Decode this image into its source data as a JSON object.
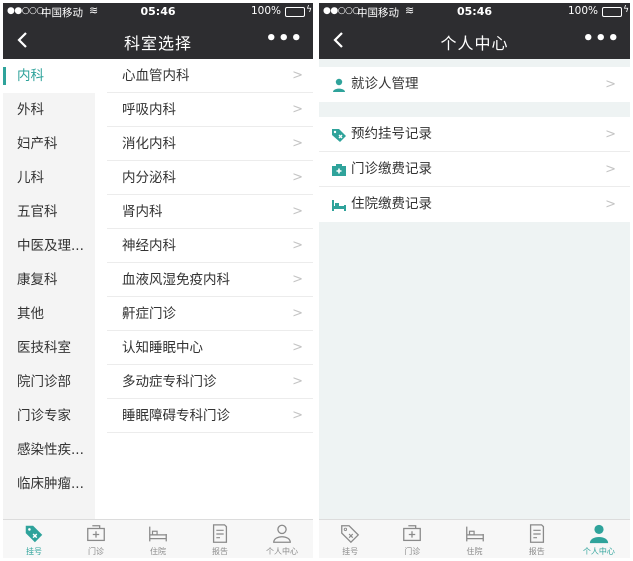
{
  "status": {
    "signal": "●●○○○",
    "carrier": "中国移动",
    "time": "05:46",
    "battery": "100%"
  },
  "left": {
    "title": "科室选择",
    "categories": [
      "内科",
      "外科",
      "妇产科",
      "儿科",
      "五官科",
      "中医及理...",
      "康复科",
      "其他",
      "医技科室",
      "院门诊部",
      "门诊专家",
      "感染性疾...",
      "临床肿瘤..."
    ],
    "active_category": "内科",
    "departments": [
      "心血管内科",
      "呼吸内科",
      "消化内科",
      "内分泌科",
      "肾内科",
      "神经内科",
      "血液风湿免疫内科",
      "鼾症门诊",
      "认知睡眠中心",
      "多动症专科门诊",
      "睡眠障碍专科门诊"
    ]
  },
  "right": {
    "title": "个人中心",
    "menu_group1": [
      "就诊人管理"
    ],
    "menu_group2": [
      "预约挂号记录",
      "门诊缴费记录",
      "住院缴费记录"
    ]
  },
  "tabs": [
    "挂号",
    "门诊",
    "住院",
    "报告",
    "个人中心"
  ],
  "colors": {
    "accent": "#2fa39b",
    "bar_dark": "#2d2d30",
    "tab_inactive": "#8a8a8a"
  },
  "icons": {
    "back": "chevron-left-icon",
    "more": "more-dots-icon",
    "row_chevron": "chevron-right-icon"
  }
}
